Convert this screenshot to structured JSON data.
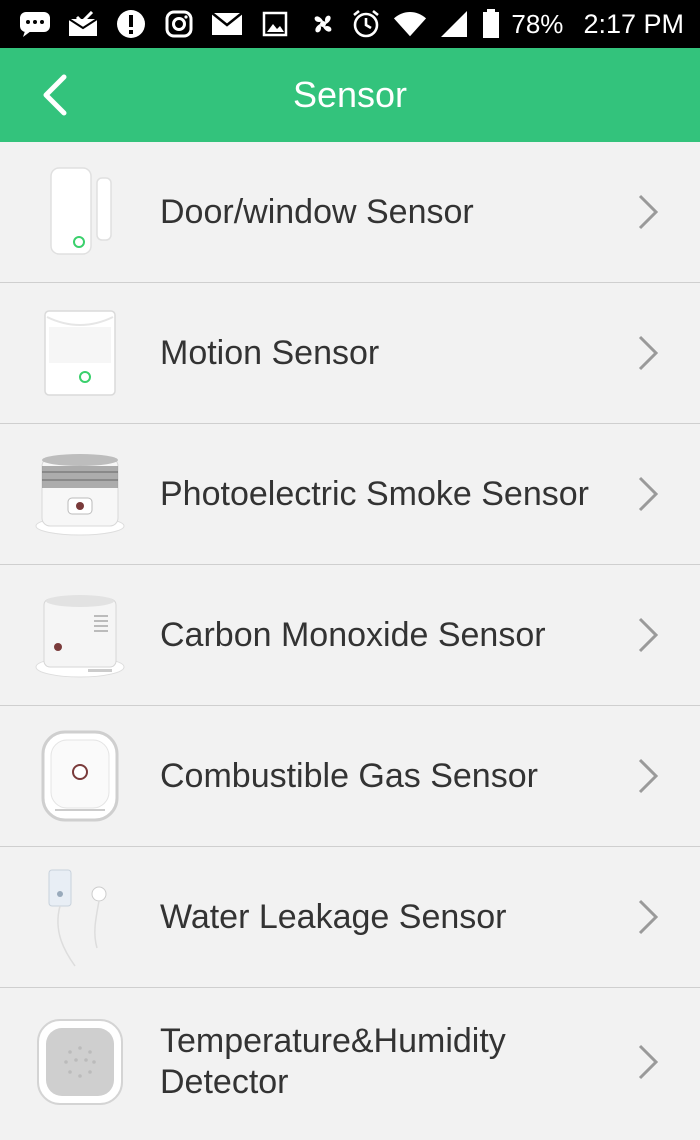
{
  "status_bar": {
    "battery": "78%",
    "time": "2:17 PM",
    "icons": [
      "chat-icon",
      "mail-check-icon",
      "alert-icon",
      "instagram-icon",
      "mail-icon",
      "gallery-icon",
      "fan-icon",
      "alarm-icon",
      "wifi-icon",
      "signal-icon",
      "battery-icon"
    ]
  },
  "header": {
    "title": "Sensor",
    "back_icon": "chevron-left-icon",
    "background": "#33c37c"
  },
  "sensors": [
    {
      "label": "Door/window Sensor",
      "icon": "door-window-sensor-image"
    },
    {
      "label": "Motion Sensor",
      "icon": "motion-sensor-image"
    },
    {
      "label": "Photoelectric Smoke Sensor",
      "icon": "smoke-sensor-image"
    },
    {
      "label": "Carbon Monoxide Sensor",
      "icon": "co-sensor-image"
    },
    {
      "label": "Combustible Gas Sensor",
      "icon": "gas-sensor-image"
    },
    {
      "label": "Water Leakage Sensor",
      "icon": "water-leak-sensor-image"
    },
    {
      "label": "Temperature&Humidity Detector",
      "icon": "temp-humidity-sensor-image"
    }
  ]
}
